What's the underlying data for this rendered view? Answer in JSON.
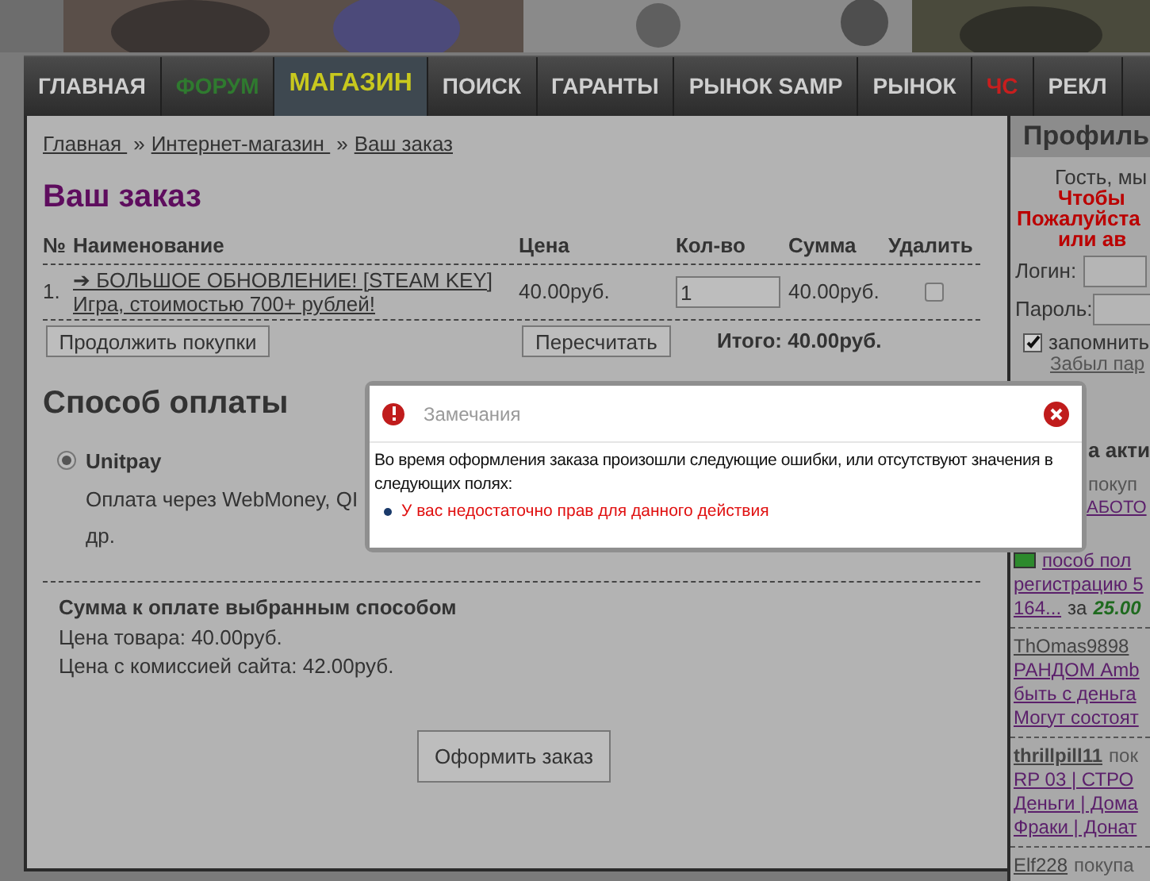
{
  "nav": [
    {
      "label": "ГЛАВНАЯ",
      "selected": false
    },
    {
      "label": "ФОРУМ",
      "color": "#2f7a2f",
      "selected": false
    },
    {
      "label": "МАГАЗИН",
      "color": "#c8c81e",
      "selected": true
    },
    {
      "label": "ПОИСК",
      "selected": false
    },
    {
      "label": "ГАРАНТЫ",
      "selected": false
    },
    {
      "label": "РЫНОК SAMP",
      "selected": false
    },
    {
      "label": "РЫНОК",
      "selected": false
    },
    {
      "label": "ЧС",
      "color": "#c81e1e",
      "selected": false
    },
    {
      "label": "РЕКЛ",
      "selected": false
    }
  ],
  "breadcrumbs": [
    "Главная ",
    "Интернет-магазин ",
    "Ваш заказ"
  ],
  "breadcrumb_separator": "»",
  "title": "Ваш заказ",
  "table": {
    "columns": [
      "№",
      "Наименование",
      "Цена",
      "Кол-во",
      "Сумма",
      "Удалить"
    ],
    "rows": [
      {
        "number": "1.",
        "name": "➔ БОЛЬШОЕ ОБНОВЛЕНИЕ! [STEAM KEY] Игра, стоимостью 700+ рублей!",
        "price": "40.00руб.",
        "quantity": "1",
        "sum": "40.00руб.",
        "delete_checked": false
      }
    ]
  },
  "continue_button": "Продолжить покупки",
  "recalc_button": "Пересчитать",
  "total": "Итого: 40.00руб.",
  "payment": {
    "title": "Способ оплаты",
    "methods": [
      {
        "name": "Unitpay",
        "selected": true,
        "description_lines": [
          "Оплата через WebMoney, QI",
          "др."
        ]
      }
    ]
  },
  "summary": {
    "title": "Сумма к оплате выбранным способом",
    "lines": [
      "Цена товара: 40.00руб.",
      "Цена с комиссией сайта: 42.00руб."
    ]
  },
  "submit_button": "Оформить заказ",
  "sidebar": {
    "title": "Профиль",
    "greeting": "Гость, мы",
    "warnings": [
      "Чтобы",
      "Пожалуйста",
      "или ав"
    ],
    "login_label": "Логин:",
    "password_label": "Пароль:",
    "remember": {
      "label": "запомнить",
      "checked": true
    },
    "forgot": "Забыл пар",
    "activity_title": "а акти",
    "activity": [
      {
        "verb": "покуп",
        "links": [
          "АБОТО",
          "пособ пол",
          "регистрацию 5",
          "164..."
        ],
        "icon": true,
        "price_prefix": "за",
        "price": "25.00"
      },
      {
        "user": "ThOmas9898",
        "links": [
          "РАНДОМ Amb",
          "быть с деньга",
          "Могут состоят"
        ]
      },
      {
        "user": "thrillpill11",
        "verb": "пок",
        "links": [
          "RP 03 | СТРО",
          "Деньги | Дома",
          "Фраки | Донат"
        ]
      },
      {
        "user": "Elf228",
        "verb": "покупа"
      }
    ]
  },
  "dialog": {
    "title": "Замечания",
    "message": "Во время оформления заказа произошли следующие ошибки, или отсутствуют значения в следующих полях:",
    "errors": [
      "У вас недостаточно прав для данного действия"
    ]
  }
}
